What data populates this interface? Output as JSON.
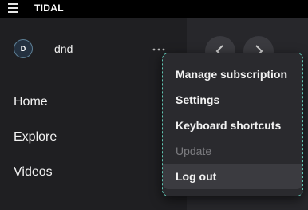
{
  "app": {
    "title": "TIDAL"
  },
  "user": {
    "initial": "D",
    "name": "dnd"
  },
  "sidebar": {
    "nav": [
      "Home",
      "Explore",
      "Videos"
    ]
  },
  "menu": {
    "items": [
      {
        "label": "Manage subscription",
        "disabled": false
      },
      {
        "label": "Settings",
        "disabled": false
      },
      {
        "label": "Keyboard shortcuts",
        "disabled": false
      },
      {
        "label": "Update",
        "disabled": true
      },
      {
        "label": "Log out",
        "disabled": false,
        "hovered": true
      }
    ]
  },
  "icons": {
    "menu": "hamburger-icon",
    "more": "more-horizontal-icon",
    "back": "chevron-left-icon",
    "forward": "chevron-right-icon"
  },
  "colors": {
    "menu_border": "#5fc7b4",
    "background": "#1b1b1e",
    "disabled_text": "#7c7c80"
  }
}
